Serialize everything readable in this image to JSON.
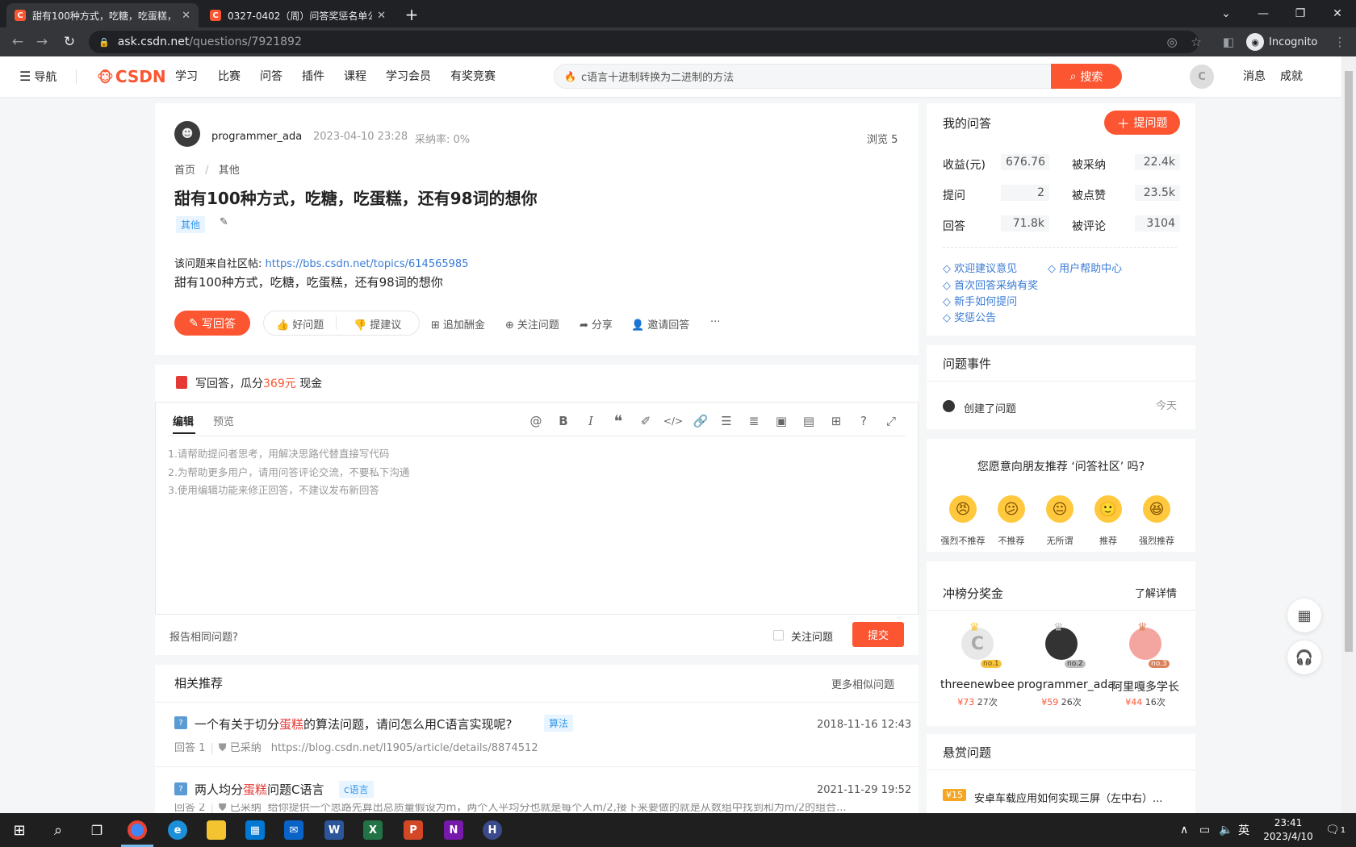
{
  "browser": {
    "tabs": [
      {
        "title": "甜有100种方式，吃糖，吃蛋糕，",
        "icon": "C"
      },
      {
        "title": "0327-0402（周）问答奖惩名单公",
        "icon": "C"
      }
    ],
    "url_host": "ask.csdn.net",
    "url_path": "/questions/7921892",
    "incognito": "Incognito"
  },
  "site": {
    "nav_label": "导航",
    "logo": "CSDN",
    "menu": [
      "学习",
      "比赛",
      "问答",
      "插件",
      "课程",
      "学习会员",
      "有奖竞赛"
    ],
    "search_placeholder": "c语言十进制转换为二进制的方法",
    "search_button": "搜索",
    "right": [
      "消息",
      "成就"
    ]
  },
  "question": {
    "author": "programmer_ada",
    "date": "2023-04-10 23:28",
    "accept_rate": "采纳率: 0%",
    "views": "浏览 5",
    "breadcrumb_home": "首页",
    "breadcrumb_sep": "/",
    "breadcrumb_cat": "其他",
    "title": "甜有100种方式，吃糖，吃蛋糕，还有98词的想你",
    "tag": "其他",
    "source_prefix": "该问题来自社区帖:",
    "source_link": "https://bbs.csdn.net/topics/614565985",
    "body": "甜有100种方式，吃糖，吃蛋糕，还有98词的想你",
    "actions": {
      "answer": "写回答",
      "good": "好问题",
      "suggest": "提建议",
      "bounty": "追加酬金",
      "follow": "关注问题",
      "share": "分享",
      "invite": "邀请回答",
      "more": "···"
    }
  },
  "answer_box": {
    "promo_prefix": "写回答，瓜分",
    "promo_amount": "369元",
    "promo_suffix": "现金",
    "tab_edit": "编辑",
    "tab_preview": "预览",
    "tips": [
      "1.请帮助提问者思考，用解决思路代替直接写代码",
      "2.为帮助更多用户，请用问答评论交流，不要私下沟通",
      "3.使用编辑功能来修正回答，不建议发布新回答"
    ],
    "report": "报告相同问题?",
    "follow": "关注问题",
    "submit": "提交"
  },
  "related": {
    "title": "相关推荐",
    "more": "更多相似问题",
    "items": [
      {
        "pre": "一个有关于切分",
        "hl": "蛋糕",
        "post": "的算法问题，请问怎么用C语言实现呢?",
        "tag": "算法",
        "date": "2018-11-16 12:43",
        "answers": "回答 1",
        "accepted": "已采纳",
        "snippet": "https://blog.csdn.net/l1905/article/details/8874512"
      },
      {
        "pre": "两人均分",
        "hl": "蛋糕",
        "post": "问题C语言",
        "tag": "c语言",
        "date": "2021-11-29 19:52",
        "answers": "回答 2",
        "accepted": "已采纳",
        "snippet": "给你提供一个思路先算出总质量假设为m，两个人平均分也就是每个人m/2,接下来要做的就是从数组中找到和为m/2的组合..."
      }
    ]
  },
  "sidebar": {
    "my_title": "我的问答",
    "ask_button": "提问题",
    "stats": [
      {
        "label": "收益(元)",
        "value": "676.76",
        "label2": "被采纳",
        "value2": "22.4k"
      },
      {
        "label": "提问",
        "value": "2",
        "label2": "被点赞",
        "value2": "23.5k"
      },
      {
        "label": "回答",
        "value": "71.8k",
        "label2": "被评论",
        "value2": "3104"
      }
    ],
    "links": [
      "欢迎建议意见",
      "用户帮助中心",
      "首次回答采纳有奖",
      "新手如何提问",
      "奖惩公告"
    ],
    "events_title": "问题事件",
    "event": "创建了问题",
    "event_time": "今天",
    "recommend_q": "您愿意向朋友推荐 ‘问答社区’ 吗?",
    "ratings": [
      "强烈不推荐",
      "不推荐",
      "无所谓",
      "推荐",
      "强烈推荐"
    ],
    "rank_title": "冲榜分奖金",
    "rank_more": "了解详情",
    "ranks": [
      {
        "name": "threenewbee",
        "badge": "no.1",
        "money": "¥73",
        "count": "27次"
      },
      {
        "name": "programmer_ada",
        "badge": "no.2",
        "money": "¥59",
        "count": "26次"
      },
      {
        "name": "阿里嘎多学长",
        "badge": "no.3",
        "money": "¥44",
        "count": "16次"
      }
    ],
    "bounty_title": "悬赏问题",
    "bounty_amount": "¥15",
    "bounty_q": "安卓车载应用如何实现三屏（左中右）..."
  },
  "taskbar": {
    "time": "23:41",
    "date": "2023/4/10",
    "ime": "英",
    "notif": "1"
  }
}
